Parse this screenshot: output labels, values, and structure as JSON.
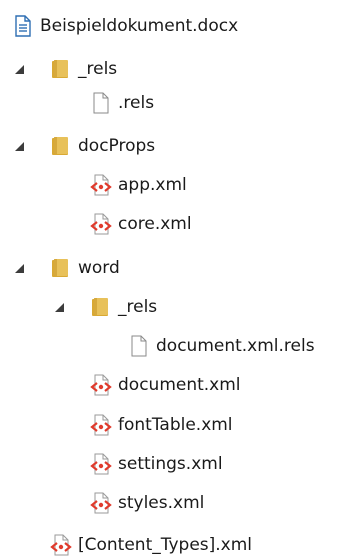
{
  "tree": {
    "items": [
      {
        "label": "Beispieldokument.docx",
        "icon": "document-icon",
        "type": "document",
        "expanded": null,
        "depth": 0
      },
      {
        "label": "_rels",
        "icon": "folder-icon",
        "type": "folder",
        "expanded": true,
        "depth": 1
      },
      {
        "label": ".rels",
        "icon": "blank-file-icon",
        "type": "file",
        "expanded": null,
        "depth": 2
      },
      {
        "label": "docProps",
        "icon": "folder-icon",
        "type": "folder",
        "expanded": true,
        "depth": 1
      },
      {
        "label": "app.xml",
        "icon": "xml-file-icon",
        "type": "xml",
        "expanded": null,
        "depth": 2
      },
      {
        "label": "core.xml",
        "icon": "xml-file-icon",
        "type": "xml",
        "expanded": null,
        "depth": 2
      },
      {
        "label": "word",
        "icon": "folder-icon",
        "type": "folder",
        "expanded": true,
        "depth": 1
      },
      {
        "label": "_rels",
        "icon": "folder-icon",
        "type": "folder",
        "expanded": true,
        "depth": 2
      },
      {
        "label": "document.xml.rels",
        "icon": "blank-file-icon",
        "type": "file",
        "expanded": null,
        "depth": 3
      },
      {
        "label": "document.xml",
        "icon": "xml-file-icon",
        "type": "xml",
        "expanded": null,
        "depth": 2
      },
      {
        "label": "fontTable.xml",
        "icon": "xml-file-icon",
        "type": "xml",
        "expanded": null,
        "depth": 2
      },
      {
        "label": "settings.xml",
        "icon": "xml-file-icon",
        "type": "xml",
        "expanded": null,
        "depth": 2
      },
      {
        "label": "styles.xml",
        "icon": "xml-file-icon",
        "type": "xml",
        "expanded": null,
        "depth": 2
      },
      {
        "label": "[Content_Types].xml",
        "icon": "xml-file-icon",
        "type": "xml",
        "expanded": null,
        "depth": 1
      }
    ]
  },
  "colors": {
    "folder": "#e8c15a",
    "folder_dark": "#d9a934",
    "xml_accent": "#e03a2c",
    "doc_accent": "#2f6fb3",
    "toggle": "#3c3c3c"
  }
}
